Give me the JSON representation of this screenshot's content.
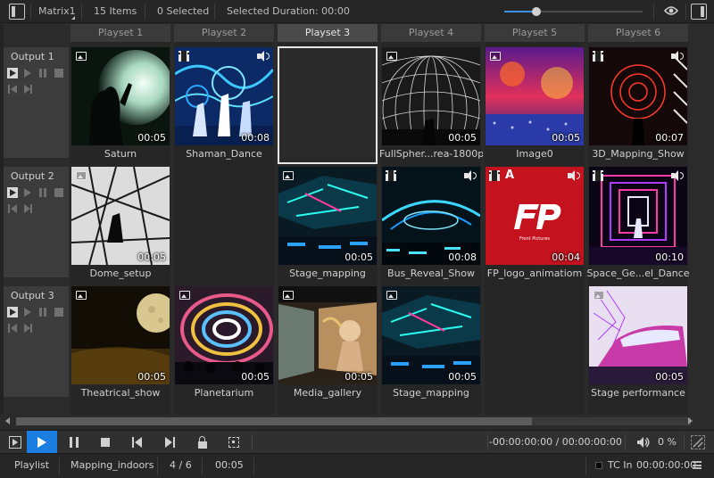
{
  "topbar": {
    "matrix_label": "Matrix1",
    "items_count": "15 Items",
    "selected_count": "0 Selected",
    "selected_duration": "Selected Duration: 00:00",
    "zoom_level": 0.23
  },
  "columns": [
    {
      "label": "Playset 1"
    },
    {
      "label": "Playset 2"
    },
    {
      "label": "Playset 3"
    },
    {
      "label": "Playset 4"
    },
    {
      "label": "Playset 5"
    },
    {
      "label": "Playset 6"
    }
  ],
  "rows": [
    {
      "label": "Output 1"
    },
    {
      "label": "Output 2"
    },
    {
      "label": "Output 3"
    }
  ],
  "cells": {
    "r1c1": {
      "caption": "Saturn",
      "duration": "00:05",
      "badge": "image"
    },
    "r1c2": {
      "caption": "Shaman_Dance",
      "duration": "00:08",
      "badge": "video",
      "audio": true
    },
    "r1c4": {
      "caption": "FullSpher...rea-1800p",
      "duration": "00:05",
      "badge": "image"
    },
    "r1c5": {
      "caption": "Image0",
      "duration": "00:05",
      "badge": "image"
    },
    "r1c6": {
      "caption": "3D_Mapping_Show",
      "duration": "00:07",
      "badge": "video",
      "audio": true
    },
    "r2c1": {
      "caption": "Dome_setup",
      "duration": "00:05",
      "badge": "image"
    },
    "r2c3": {
      "caption": "Stage_mapping",
      "duration": "00:05",
      "badge": "image"
    },
    "r2c4": {
      "caption": "Bus_Reveal_Show",
      "duration": "00:08",
      "badge": "video",
      "audio": true
    },
    "r2c5": {
      "caption": "FP_logo_animatiom",
      "duration": "00:04",
      "badge": "video",
      "audio": true,
      "tag": "A",
      "logo_text": "Front Pictures"
    },
    "r2c6": {
      "caption": "Space_Ge...el_Dance",
      "duration": "00:10",
      "badge": "video",
      "audio": true
    },
    "r3c1": {
      "caption": "Theatrical_show",
      "duration": "00:05",
      "badge": "image"
    },
    "r3c2": {
      "caption": "Planetarium",
      "duration": "00:05",
      "badge": "image"
    },
    "r3c3": {
      "caption": "Media_gallery",
      "duration": "00:05",
      "badge": "image"
    },
    "r3c4": {
      "caption": "Stage_mapping",
      "duration": "00:05",
      "badge": "image"
    },
    "r3c6": {
      "caption": "Stage performance",
      "duration": "00:05",
      "badge": "image"
    }
  },
  "transport": {
    "timecode": "-00:00:00:00 / 00:00:00:00",
    "volume": "0 %"
  },
  "status": {
    "mode": "Playlist",
    "project": "Mapping_indoors",
    "position": "4 / 6",
    "duration": "00:05",
    "tc_label": "TC In",
    "tc_value": "00:00:00:00"
  },
  "colors": {
    "accent": "#1a7fe0",
    "background": "#2b2b2b"
  }
}
